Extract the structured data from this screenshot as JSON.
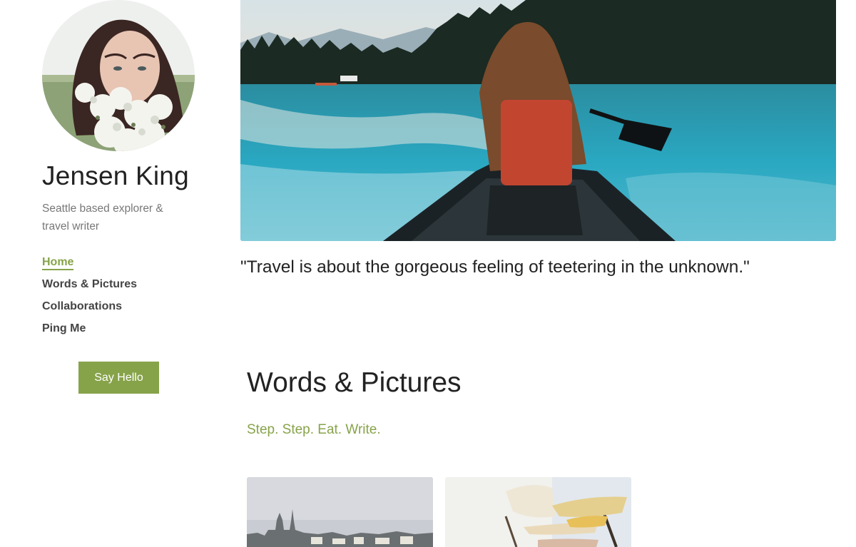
{
  "profile": {
    "name": "Jensen King",
    "tagline": "Seattle based explorer & travel writer",
    "avatar_icon": "portrait-photo"
  },
  "nav": {
    "items": [
      {
        "label": "Home",
        "active": true
      },
      {
        "label": "Words & Pictures",
        "active": false
      },
      {
        "label": "Collaborations",
        "active": false
      },
      {
        "label": "Ping Me",
        "active": false
      }
    ]
  },
  "cta": {
    "say_hello_label": "Say Hello"
  },
  "hero": {
    "quote": "\"Travel is about the gorgeous feeling of teetering in the unknown.\""
  },
  "section": {
    "title": "Words & Pictures",
    "subtitle": "Step. Step. Eat. Write."
  },
  "colors": {
    "accent": "#87a34a",
    "text": "#222222",
    "muted": "#777777"
  }
}
